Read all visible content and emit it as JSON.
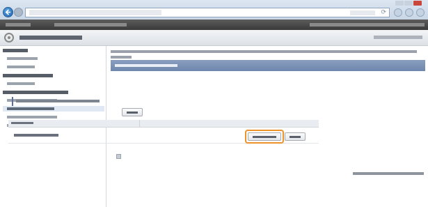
{
  "window": {
    "title": "",
    "controls": [
      "minimize-icon",
      "maximize-icon",
      "close-icon"
    ]
  },
  "browser": {
    "address_url": "",
    "address_controls": "",
    "toolbar_icons": [
      "home-icon",
      "star-icon",
      "gear-icon"
    ]
  },
  "banner": {
    "left_label": "",
    "center_label": "",
    "right_label": ""
  },
  "page": {
    "title": "",
    "title_icon": "settings-gear-icon",
    "right_link": ""
  },
  "sidebar": {
    "items": [
      {
        "label": "",
        "type": "heading"
      },
      {
        "label": "",
        "type": "item"
      },
      {
        "label": "",
        "type": "item"
      },
      {
        "label": "",
        "type": "heading"
      },
      {
        "label": "",
        "type": "item"
      },
      {
        "label": "",
        "type": "heading"
      },
      {
        "label": "",
        "type": "item"
      },
      {
        "label": "",
        "type": "item",
        "active": true
      },
      {
        "label": "",
        "type": "item"
      },
      {
        "label": "",
        "type": "item"
      }
    ]
  },
  "content": {
    "description": "",
    "section_title": "",
    "subsection_title": "",
    "top_button": "",
    "table": {
      "header": "",
      "row": {
        "name": "",
        "primary_button": "",
        "secondary_button": ""
      }
    },
    "footer_text": ""
  },
  "colors": {
    "highlight_border": "#f0922b",
    "section_header": "#7a90b5",
    "banner": "#4a4a4a"
  }
}
